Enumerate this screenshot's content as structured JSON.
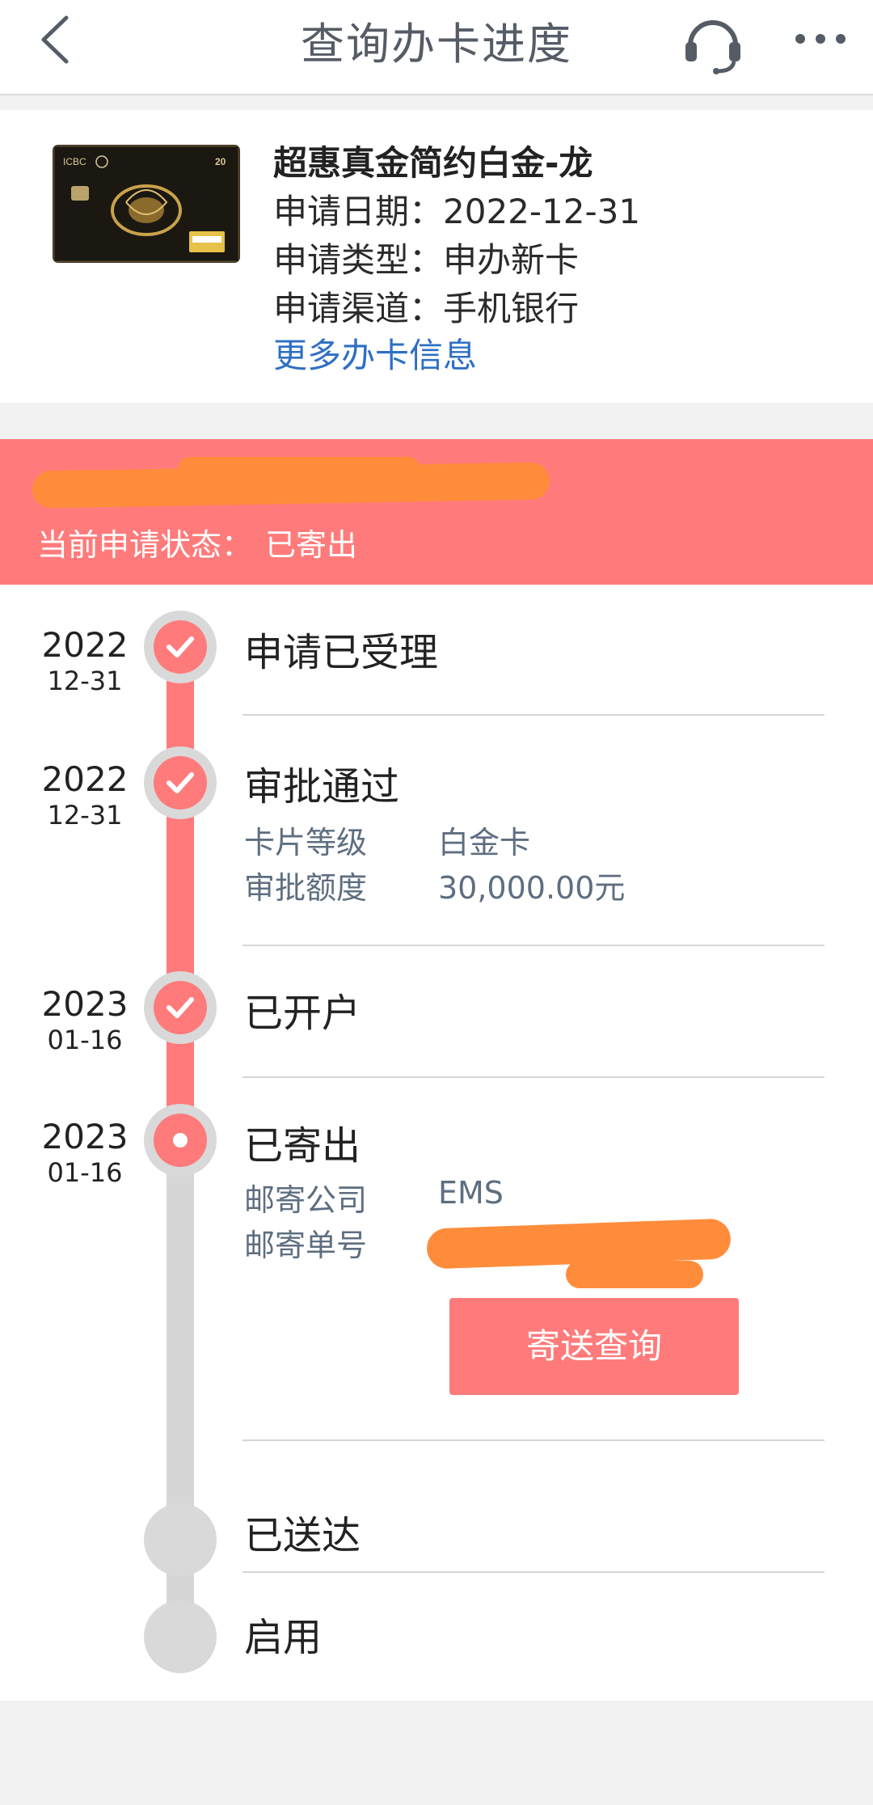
{
  "header": {
    "title": "查询办卡进度"
  },
  "card": {
    "name": "超惠真金简约白金-龙",
    "apply_date": "申请日期：2022-12-31",
    "apply_type": "申请类型：申办新卡",
    "apply_channel": "申请渠道：手机银行",
    "more_info_link": "更多办卡信息",
    "image_text": {
      "bank": "ICBC",
      "number": "20"
    }
  },
  "status": {
    "label": "当前申请状态：",
    "value": "已寄出"
  },
  "steps": [
    {
      "title": "申请已受理",
      "year": "2022",
      "date": "12-31",
      "state": "done"
    },
    {
      "title": "审批通过",
      "year": "2022",
      "date": "12-31",
      "state": "done",
      "details": [
        {
          "label": "卡片等级",
          "value": "白金卡"
        },
        {
          "label": "审批额度",
          "value": "30,000.00元"
        }
      ]
    },
    {
      "title": "已开户",
      "year": "2023",
      "date": "01-16",
      "state": "done"
    },
    {
      "title": "已寄出",
      "year": "2023",
      "date": "01-16",
      "state": "current",
      "details": [
        {
          "label": "邮寄公司",
          "value": "EMS"
        },
        {
          "label": "邮寄单号",
          "value": ""
        }
      ],
      "button": "寄送查询"
    },
    {
      "title": "已送达",
      "state": "pending"
    },
    {
      "title": "启用",
      "state": "pending"
    }
  ],
  "colors": {
    "accent": "#ff7b7b",
    "link": "#2e6fc4",
    "redaction": "#ff8c3a",
    "rail_pending": "#d6d6d6"
  },
  "icons": {
    "back": "chevron-left-icon",
    "support": "headset-icon",
    "more": "more-dots-icon",
    "step_done": "check-icon"
  }
}
